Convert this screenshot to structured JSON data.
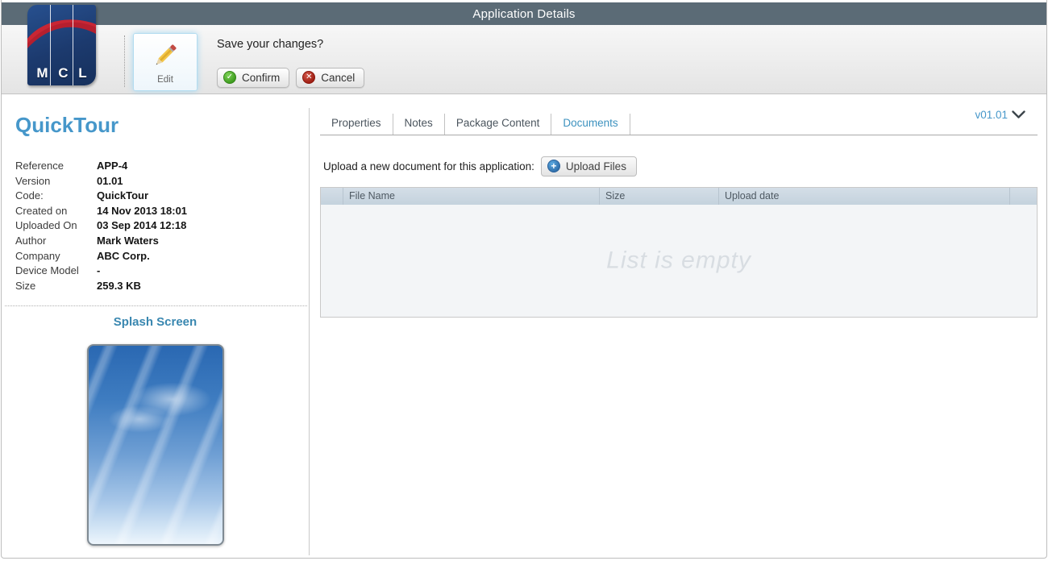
{
  "titlebar": {
    "title": "Application Details"
  },
  "logo": {
    "letters": [
      "M",
      "C",
      "L"
    ]
  },
  "toolbar": {
    "edit_label": "Edit",
    "save_prompt": "Save your changes?",
    "confirm_label": "Confirm",
    "cancel_label": "Cancel"
  },
  "app": {
    "name": "QuickTour",
    "properties": [
      {
        "label": "Reference",
        "value": "APP-4"
      },
      {
        "label": "Version",
        "value": "01.01"
      },
      {
        "label": "Code:",
        "value": "QuickTour"
      },
      {
        "label": "Created on",
        "value": "14 Nov 2013 18:01"
      },
      {
        "label": "Uploaded On",
        "value": "03 Sep 2014 12:18"
      },
      {
        "label": "Author",
        "value": "Mark Waters"
      },
      {
        "label": "Company",
        "value": "ABC Corp."
      },
      {
        "label": "Device Model",
        "value": "-"
      },
      {
        "label": "Size",
        "value": "259.3 KB"
      }
    ],
    "splash_title": "Splash Screen"
  },
  "main": {
    "version_selector": "v01.01",
    "tabs": [
      {
        "label": "Properties",
        "active": false
      },
      {
        "label": "Notes",
        "active": false
      },
      {
        "label": "Package Content",
        "active": false
      },
      {
        "label": "Documents",
        "active": true
      }
    ],
    "upload_prompt": "Upload a new document for this application:",
    "upload_button": "Upload Files",
    "table": {
      "columns": [
        "File Name",
        "Size",
        "Upload date"
      ],
      "rows": [],
      "empty_message": "List is empty"
    }
  },
  "colors": {
    "titlebar_bg": "#5b6b76",
    "accent_blue": "#4697ca",
    "active_tab": "#3d92bf",
    "confirm_green": "#3d9a1e",
    "cancel_red": "#9d1d12",
    "table_header_bg": "#c9d6e0"
  }
}
